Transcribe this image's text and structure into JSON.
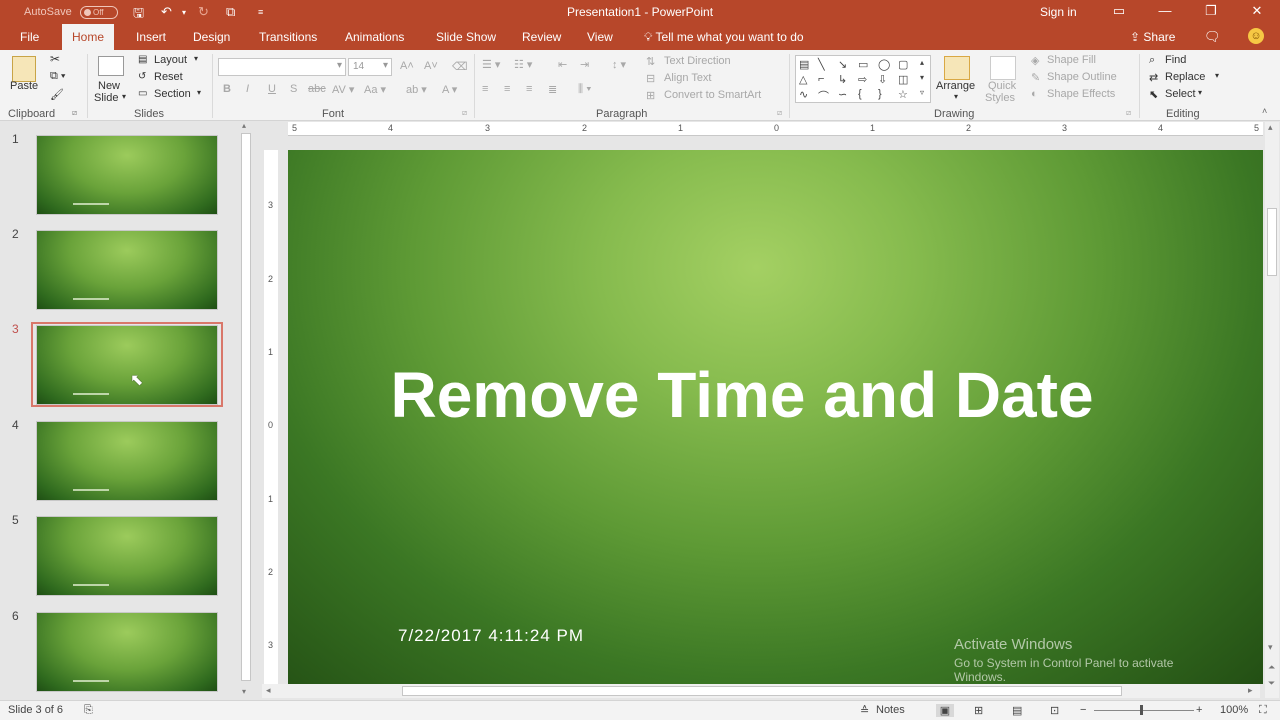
{
  "titlebar": {
    "autosave_label": "AutoSave",
    "autosave_state": "Off",
    "title": "Presentation1  -  PowerPoint",
    "signin": "Sign in"
  },
  "tabs": [
    "File",
    "Home",
    "Insert",
    "Design",
    "Transitions",
    "Animations",
    "Slide Show",
    "Review",
    "View"
  ],
  "active_tab": "Home",
  "tell_me": "Tell me what you want to do",
  "share_label": "Share",
  "ribbon": {
    "clipboard": {
      "label": "Clipboard",
      "paste": "Paste"
    },
    "slides": {
      "label": "Slides",
      "new_slide_1": "New",
      "new_slide_2": "Slide",
      "layout": "Layout",
      "reset": "Reset",
      "section": "Section"
    },
    "font": {
      "label": "Font",
      "font_size": "14"
    },
    "paragraph": {
      "label": "Paragraph",
      "text_direction": "Text Direction",
      "align_text": "Align Text",
      "convert_smartart": "Convert to SmartArt"
    },
    "drawing": {
      "label": "Drawing",
      "arrange": "Arrange",
      "quick_styles_1": "Quick",
      "quick_styles_2": "Styles",
      "shape_fill": "Shape Fill",
      "shape_outline": "Shape Outline",
      "shape_effects": "Shape Effects"
    },
    "editing": {
      "label": "Editing",
      "find": "Find",
      "replace": "Replace",
      "select": "Select"
    }
  },
  "slides": [
    "1",
    "2",
    "3",
    "4",
    "5",
    "6"
  ],
  "selected_slide": "3",
  "ruler_h": [
    "5",
    "4",
    "3",
    "2",
    "1",
    "0",
    "1",
    "2",
    "3",
    "4",
    "5"
  ],
  "ruler_v": [
    "3",
    "2",
    "1",
    "0",
    "1",
    "2",
    "3"
  ],
  "slide": {
    "title": "Remove Time and Date",
    "date": "7/22/2017 4:11:24 PM"
  },
  "watermark": {
    "line1": "Activate Windows",
    "line2": "Go to System in Control Panel to activate",
    "line3": "Windows."
  },
  "status": {
    "slide_info": "Slide 3 of 6",
    "notes": "Notes",
    "zoom": "100%"
  },
  "colors": {
    "accent": "#b7472a",
    "selection": "#d9776a"
  }
}
